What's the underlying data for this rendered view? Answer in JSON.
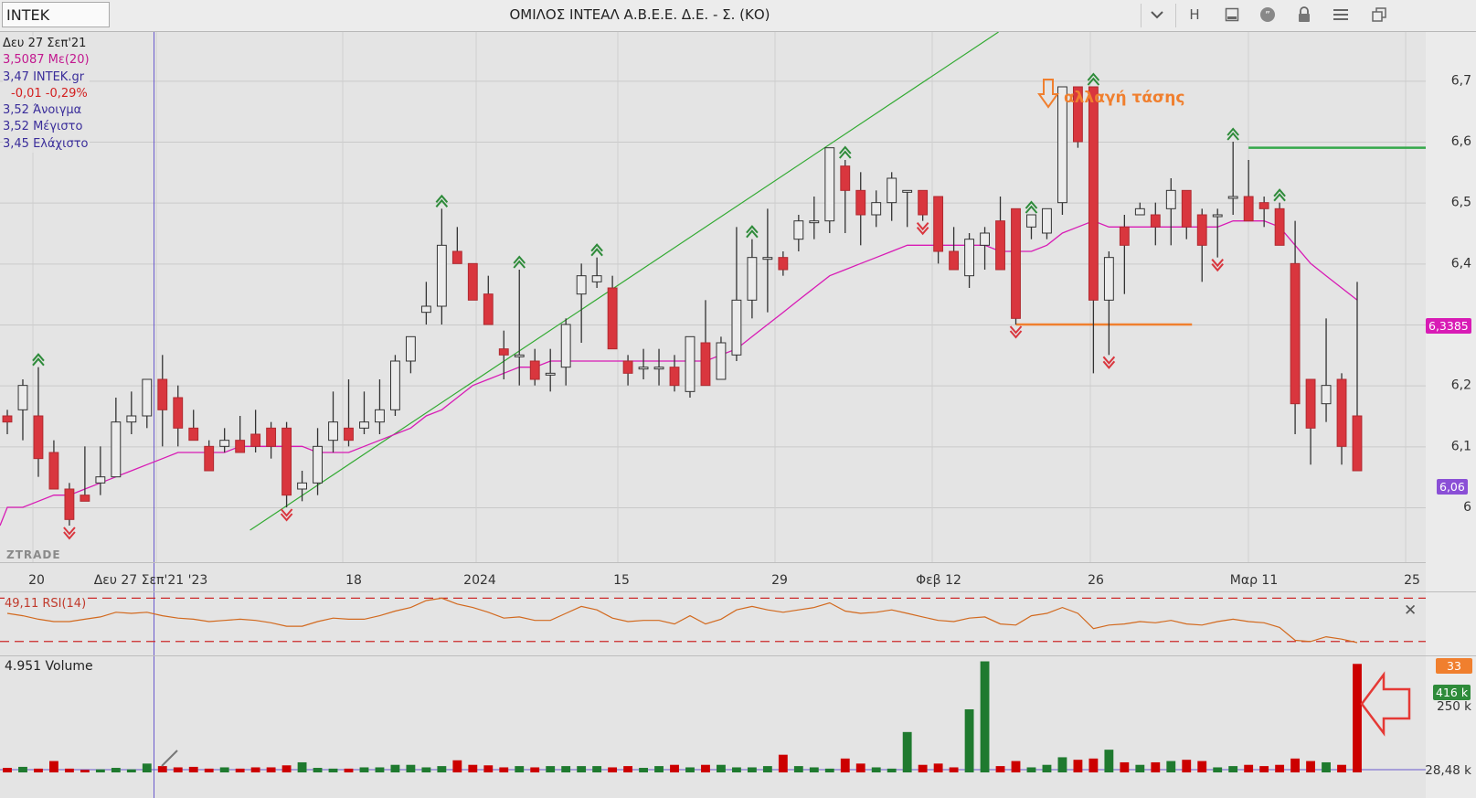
{
  "window": {
    "symbol": "INTEK",
    "title": "ΟΜΙΛΟΣ ΙΝΤΕΑΛ Α.Β.Ε.Ε. Δ.Ε. - Σ. (ΚΟ)",
    "h_label": "H"
  },
  "info": {
    "date": "Δευ 27 Σεπ'21",
    "ma": "3,5087 Με(20)",
    "last": "3,47 INTEK.gr",
    "change": "-0,01 -0,29%",
    "open": "3,52 Άνοιγμα",
    "high": "3,52 Μέγιστο",
    "low": "3,45 Ελάχιστο"
  },
  "watermark": "ZTRADE",
  "annotation": "αλλαγή τάσης",
  "rsi": {
    "label": "49,11 RSI(14)",
    "badge": "33",
    "close_symbol": "✕"
  },
  "volume": {
    "label": "4.951 Volume",
    "badge": "416 k"
  },
  "badges": {
    "ma": "6,3385",
    "last": "6,06"
  },
  "colors": {
    "up": "#ececec",
    "down": "#d9363e",
    "neutral": "#555555",
    "ma": "#d81bb5",
    "trend": "#33aa33",
    "support": "#f07f2e",
    "resistance": "#35a84a",
    "vol_up": "#1f7a2f",
    "vol_down": "#cc0000"
  },
  "chart_data": [
    {
      "type": "candlestick",
      "x_labels": [
        "20",
        "Δευ 27 Σεπ'21 '23",
        "18",
        "2024",
        "15",
        "29",
        "Φεβ 12",
        "26",
        "Μαρ 11",
        "25"
      ],
      "y_ticks": [
        "6",
        "6,1",
        "6,2",
        "6,3",
        "6,4",
        "6,5",
        "6,6",
        "6,7"
      ],
      "ylim": [
        5.91,
        6.78
      ],
      "ohlc": [
        [
          6.15,
          6.16,
          6.12,
          6.14
        ],
        [
          6.16,
          6.21,
          6.11,
          6.2
        ],
        [
          6.15,
          6.23,
          6.05,
          6.08
        ],
        [
          6.09,
          6.11,
          6.03,
          6.03
        ],
        [
          6.03,
          6.04,
          5.97,
          5.98
        ],
        [
          6.02,
          6.1,
          6.01,
          6.01
        ],
        [
          6.04,
          6.1,
          6.02,
          6.05
        ],
        [
          6.05,
          6.18,
          6.05,
          6.14
        ],
        [
          6.14,
          6.19,
          6.12,
          6.15
        ],
        [
          6.15,
          6.21,
          6.13,
          6.21
        ],
        [
          6.21,
          6.25,
          6.1,
          6.16
        ],
        [
          6.18,
          6.2,
          6.1,
          6.13
        ],
        [
          6.13,
          6.16,
          6.11,
          6.11
        ],
        [
          6.1,
          6.11,
          6.06,
          6.06
        ],
        [
          6.1,
          6.13,
          6.09,
          6.11
        ],
        [
          6.11,
          6.15,
          6.09,
          6.09
        ],
        [
          6.12,
          6.16,
          6.09,
          6.1
        ],
        [
          6.13,
          6.14,
          6.08,
          6.1
        ],
        [
          6.13,
          6.14,
          6.0,
          6.02
        ],
        [
          6.03,
          6.06,
          6.01,
          6.04
        ],
        [
          6.04,
          6.13,
          6.02,
          6.1
        ],
        [
          6.11,
          6.19,
          6.09,
          6.14
        ],
        [
          6.13,
          6.21,
          6.1,
          6.11
        ],
        [
          6.13,
          6.19,
          6.12,
          6.14
        ],
        [
          6.14,
          6.21,
          6.12,
          6.16
        ],
        [
          6.16,
          6.25,
          6.15,
          6.24
        ],
        [
          6.24,
          6.28,
          6.22,
          6.28
        ],
        [
          6.32,
          6.37,
          6.3,
          6.33
        ],
        [
          6.33,
          6.49,
          6.3,
          6.43
        ],
        [
          6.42,
          6.46,
          6.41,
          6.4
        ],
        [
          6.4,
          6.4,
          6.34,
          6.34
        ],
        [
          6.35,
          6.38,
          6.3,
          6.3
        ],
        [
          6.26,
          6.29,
          6.21,
          6.25
        ],
        [
          6.25,
          6.39,
          6.2,
          6.25
        ],
        [
          6.24,
          6.26,
          6.2,
          6.21
        ],
        [
          6.22,
          6.26,
          6.19,
          6.22
        ],
        [
          6.23,
          6.31,
          6.2,
          6.3
        ],
        [
          6.35,
          6.4,
          6.27,
          6.38
        ],
        [
          6.37,
          6.41,
          6.36,
          6.38
        ],
        [
          6.36,
          6.38,
          6.26,
          6.26
        ],
        [
          6.24,
          6.25,
          6.2,
          6.22
        ],
        [
          6.23,
          6.26,
          6.21,
          6.23
        ],
        [
          6.23,
          6.26,
          6.2,
          6.23
        ],
        [
          6.23,
          6.25,
          6.19,
          6.2
        ],
        [
          6.19,
          6.28,
          6.18,
          6.28
        ],
        [
          6.27,
          6.34,
          6.2,
          6.2
        ],
        [
          6.21,
          6.28,
          6.21,
          6.27
        ],
        [
          6.25,
          6.46,
          6.24,
          6.34
        ],
        [
          6.34,
          6.44,
          6.31,
          6.41
        ],
        [
          6.41,
          6.49,
          6.32,
          6.41
        ],
        [
          6.41,
          6.42,
          6.38,
          6.39
        ],
        [
          6.44,
          6.48,
          6.42,
          6.47
        ],
        [
          6.47,
          6.51,
          6.44,
          6.47
        ],
        [
          6.47,
          6.59,
          6.45,
          6.59
        ],
        [
          6.56,
          6.57,
          6.45,
          6.52
        ],
        [
          6.52,
          6.55,
          6.43,
          6.48
        ],
        [
          6.48,
          6.52,
          6.46,
          6.5
        ],
        [
          6.5,
          6.55,
          6.47,
          6.54
        ],
        [
          6.52,
          6.52,
          6.46,
          6.52
        ],
        [
          6.52,
          6.51,
          6.47,
          6.48
        ],
        [
          6.51,
          6.51,
          6.4,
          6.42
        ],
        [
          6.42,
          6.46,
          6.39,
          6.39
        ],
        [
          6.38,
          6.45,
          6.36,
          6.44
        ],
        [
          6.43,
          6.46,
          6.39,
          6.45
        ],
        [
          6.47,
          6.51,
          6.43,
          6.39
        ],
        [
          6.49,
          6.49,
          6.3,
          6.31
        ],
        [
          6.46,
          6.48,
          6.44,
          6.48
        ],
        [
          6.45,
          6.49,
          6.44,
          6.49
        ],
        [
          6.5,
          6.69,
          6.48,
          6.69
        ],
        [
          6.69,
          6.69,
          6.59,
          6.6
        ],
        [
          6.69,
          6.69,
          6.22,
          6.34
        ],
        [
          6.34,
          6.42,
          6.25,
          6.41
        ],
        [
          6.46,
          6.48,
          6.35,
          6.43
        ],
        [
          6.48,
          6.5,
          6.48,
          6.49
        ],
        [
          6.48,
          6.5,
          6.43,
          6.46
        ],
        [
          6.49,
          6.54,
          6.43,
          6.52
        ],
        [
          6.52,
          6.52,
          6.44,
          6.46
        ],
        [
          6.48,
          6.49,
          6.37,
          6.43
        ],
        [
          6.48,
          6.49,
          6.41,
          6.48
        ],
        [
          6.51,
          6.6,
          6.48,
          6.51
        ],
        [
          6.51,
          6.57,
          6.47,
          6.47
        ],
        [
          6.5,
          6.51,
          6.46,
          6.49
        ],
        [
          6.49,
          6.5,
          6.43,
          6.43
        ],
        [
          6.4,
          6.47,
          6.12,
          6.17
        ],
        [
          6.21,
          6.21,
          6.07,
          6.13
        ],
        [
          6.17,
          6.31,
          6.14,
          6.2
        ],
        [
          6.21,
          6.22,
          6.07,
          6.1
        ],
        [
          6.15,
          6.37,
          6.06,
          6.06
        ]
      ],
      "ma_label": "Με(20)",
      "ma": [
        6.0,
        6.0,
        6.01,
        6.02,
        6.02,
        6.03,
        6.04,
        6.05,
        6.06,
        6.07,
        6.08,
        6.09,
        6.09,
        6.09,
        6.09,
        6.1,
        6.1,
        6.1,
        6.1,
        6.1,
        6.09,
        6.09,
        6.09,
        6.1,
        6.11,
        6.12,
        6.13,
        6.15,
        6.16,
        6.18,
        6.2,
        6.21,
        6.22,
        6.23,
        6.23,
        6.24,
        6.24,
        6.24,
        6.24,
        6.24,
        6.24,
        6.24,
        6.24,
        6.24,
        6.24,
        6.24,
        6.25,
        6.26,
        6.28,
        6.3,
        6.32,
        6.34,
        6.36,
        6.38,
        6.39,
        6.4,
        6.41,
        6.42,
        6.43,
        6.43,
        6.43,
        6.43,
        6.43,
        6.43,
        6.42,
        6.42,
        6.42,
        6.43,
        6.45,
        6.46,
        6.47,
        6.46,
        6.46,
        6.46,
        6.46,
        6.46,
        6.46,
        6.46,
        6.46,
        6.47,
        6.47,
        6.47,
        6.46,
        6.43,
        6.4,
        6.38,
        6.36,
        6.34
      ],
      "trendline": [
        [
          18,
          6.0
        ],
        [
          63,
          6.78
        ]
      ],
      "support": {
        "value": 6.3,
        "from": 65,
        "to": 76
      },
      "resistance": {
        "value": 6.59,
        "from": 80,
        "to": 88
      }
    },
    {
      "type": "line",
      "name": "RSI(14)",
      "ylim": [
        25,
        75
      ],
      "upper": 70,
      "lower": 33,
      "values": [
        57,
        55,
        52,
        50,
        50,
        52,
        54,
        58,
        57,
        58,
        55,
        53,
        52,
        50,
        51,
        52,
        51,
        49,
        46,
        46,
        50,
        53,
        52,
        52,
        55,
        59,
        62,
        68,
        70,
        65,
        62,
        58,
        53,
        54,
        51,
        51,
        57,
        63,
        60,
        53,
        50,
        51,
        51,
        48,
        55,
        48,
        52,
        60,
        63,
        60,
        58,
        60,
        62,
        66,
        59,
        57,
        58,
        60,
        57,
        54,
        51,
        50,
        53,
        54,
        48,
        47,
        55,
        57,
        62,
        57,
        44,
        47,
        48,
        50,
        49,
        51,
        48,
        47,
        50,
        52,
        50,
        49,
        45,
        34,
        33,
        37,
        35,
        32
      ]
    },
    {
      "type": "bar",
      "name": "Volume",
      "y_ticks": [
        "28,48 k",
        "250 k",
        "416 k"
      ],
      "ylim": [
        0,
        460
      ],
      "values": [
        18,
        22,
        15,
        45,
        15,
        10,
        12,
        18,
        12,
        35,
        25,
        20,
        22,
        15,
        20,
        15,
        20,
        20,
        28,
        40,
        18,
        15,
        15,
        20,
        20,
        30,
        30,
        20,
        25,
        48,
        30,
        28,
        20,
        25,
        20,
        25,
        25,
        25,
        25,
        20,
        25,
        18,
        25,
        30,
        20,
        30,
        30,
        20,
        20,
        25,
        70,
        25,
        20,
        15,
        55,
        35,
        20,
        15,
        160,
        30,
        35,
        20,
        250,
        440,
        25,
        45,
        20,
        30,
        60,
        50,
        55,
        90,
        40,
        30,
        40,
        45,
        50,
        45,
        20,
        25,
        30,
        25,
        30,
        55,
        45,
        40,
        30,
        430
      ]
    }
  ]
}
